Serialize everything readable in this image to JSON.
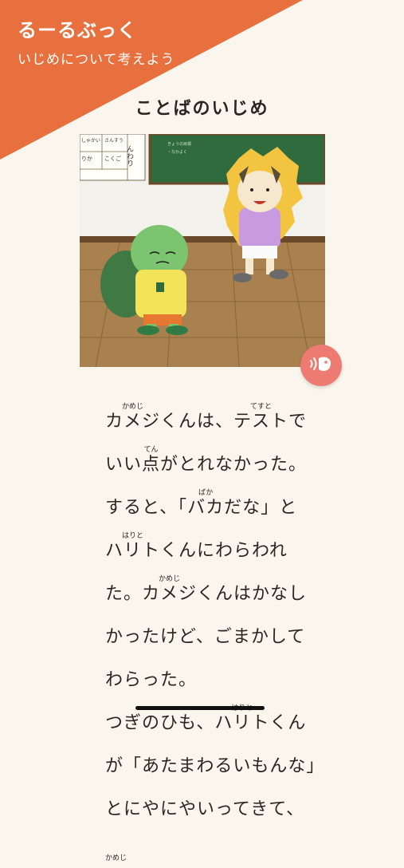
{
  "app": {
    "brand": "るーるぶっく",
    "subtitle": "いじめについて考えよう"
  },
  "page": {
    "title": "ことばのいじめ"
  },
  "illustration": {
    "board_words": [
      "しゃかい",
      "さんすう",
      "りか",
      "こくご"
    ],
    "board_chars": "んわり"
  },
  "colors": {
    "accent": "#e8703e",
    "audio_button": "#ee7b72",
    "background": "#faf6ed"
  },
  "audio_button": {
    "icon": "speaker-icon"
  },
  "story": {
    "lines": [
      [
        {
          "t": "カメジ",
          "r": "かめじ"
        },
        {
          "t": "くんは、"
        },
        {
          "t": "テスト",
          "r": "てすと"
        },
        {
          "t": "で"
        }
      ],
      [
        {
          "t": "いい"
        },
        {
          "t": "点",
          "r": "てん"
        },
        {
          "t": "がとれなかった。"
        }
      ],
      [
        {
          "t": "すると、「"
        },
        {
          "t": "バカ",
          "r": "ばか"
        },
        {
          "t": "だな」と"
        }
      ],
      [
        {
          "t": "ハリト",
          "r": "はりと"
        },
        {
          "t": "くんにわらわれ"
        }
      ],
      [
        {
          "t": "た。"
        },
        {
          "t": "カメジ",
          "r": "かめじ"
        },
        {
          "t": "くんはかなし"
        }
      ],
      [
        {
          "t": "かったけど、ごまかして"
        }
      ],
      [
        {
          "t": "わらった。"
        }
      ],
      [
        {
          "t": "つぎのひも、"
        },
        {
          "t": "ハリト",
          "r": "はりと"
        },
        {
          "t": "くん"
        }
      ],
      [
        {
          "t": "が「あたまわるいもんな」"
        }
      ],
      [
        {
          "t": "とにやにやいってきて、"
        }
      ],
      [
        {
          "t": "",
          "r": "かめじ"
        }
      ]
    ]
  }
}
